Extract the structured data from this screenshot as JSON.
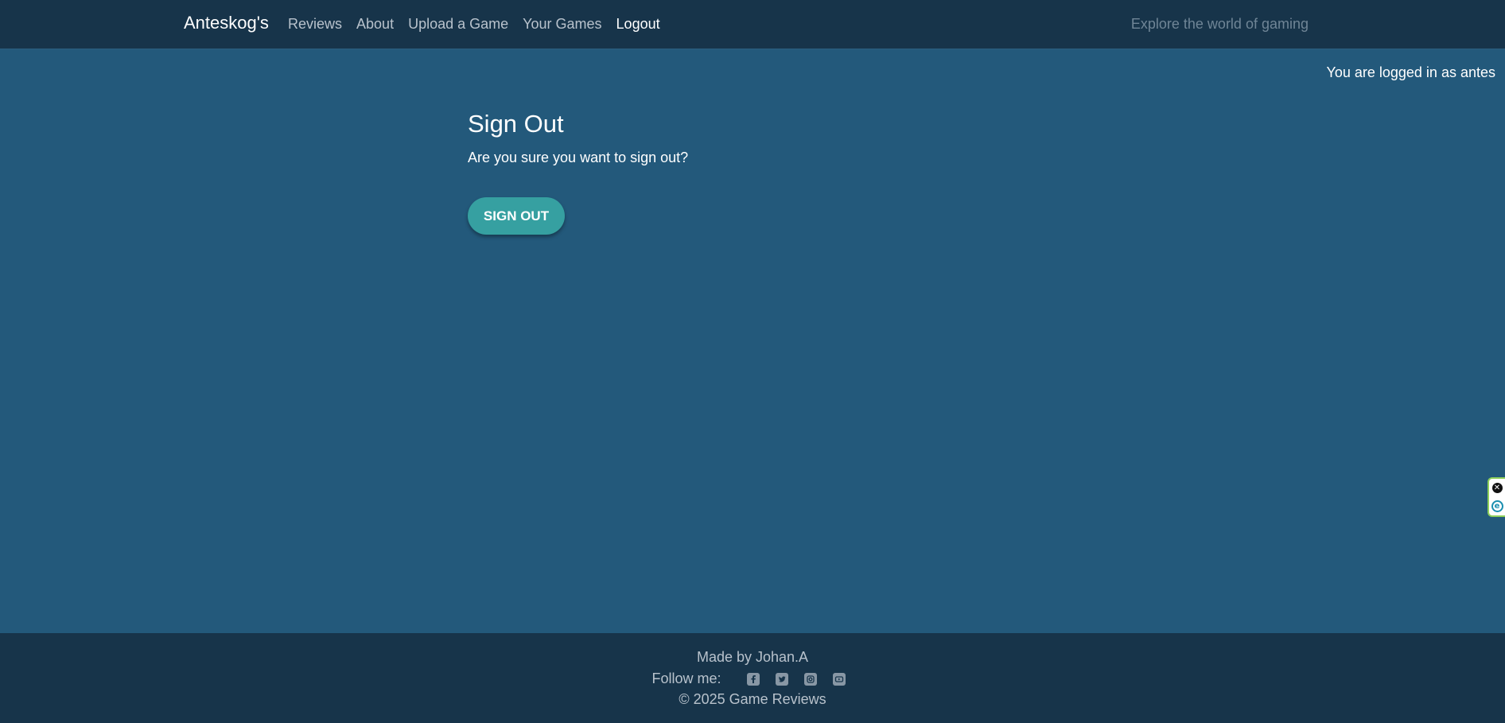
{
  "navbar": {
    "brand": "Anteskog's",
    "links": [
      {
        "label": "Reviews"
      },
      {
        "label": "About"
      },
      {
        "label": "Upload a Game"
      },
      {
        "label": "Your Games"
      },
      {
        "label": "Logout",
        "active": true
      }
    ],
    "tagline": "Explore the world of gaming"
  },
  "status": {
    "login_text": "You are logged in as antes"
  },
  "main": {
    "title": "Sign Out",
    "question": "Are you sure you want to sign out?",
    "button_label": "SIGN OUT"
  },
  "footer": {
    "made_by": "Made by Johan.A",
    "follow_label": "Follow me:",
    "socials": [
      "facebook-icon",
      "twitter-icon",
      "instagram-icon",
      "youtube-icon"
    ],
    "copyright": "© 2025 Game Reviews"
  },
  "colors": {
    "page_bg": "#23597b",
    "navbar_bg": "#17344a",
    "button_bg": "#36a0a1"
  }
}
